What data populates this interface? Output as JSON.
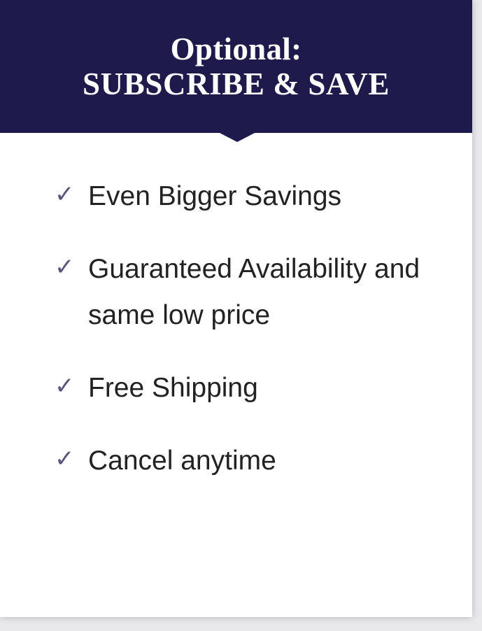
{
  "header": {
    "line1": "Optional:",
    "line2": "SUBSCRIBE & SAVE"
  },
  "features": [
    {
      "text": "Even Bigger Savings",
      "icon": "checkmark-icon"
    },
    {
      "text": "Guaranteed Availability and same low price",
      "icon": "checkmark-icon"
    },
    {
      "text": "Free Shipping",
      "icon": "checkmark-icon"
    },
    {
      "text": "Cancel anytime",
      "icon": "checkmark-icon"
    }
  ],
  "colors": {
    "header_background": "#1e1a4c",
    "checkmark": "#5a557a",
    "text": "#222222"
  }
}
